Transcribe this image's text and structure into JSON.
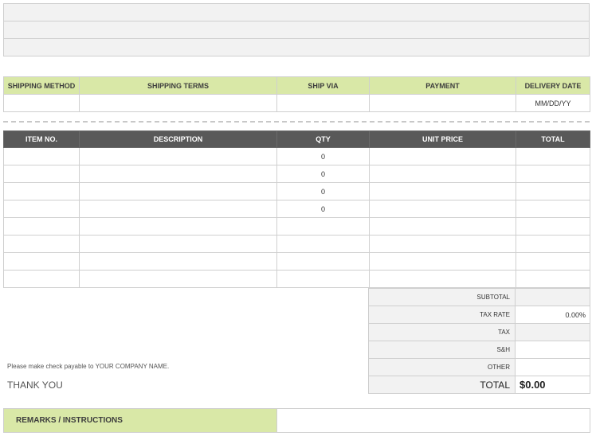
{
  "shipping": {
    "headers": [
      "SHIPPING METHOD",
      "SHIPPING TERMS",
      "SHIP VIA",
      "PAYMENT",
      "DELIVERY DATE"
    ],
    "values": [
      "",
      "",
      "",
      "",
      "MM/DD/YY"
    ]
  },
  "items": {
    "headers": [
      "ITEM NO.",
      "DESCRIPTION",
      "QTY",
      "UNIT PRICE",
      "TOTAL"
    ],
    "rows": [
      [
        "",
        "",
        "0",
        "",
        ""
      ],
      [
        "",
        "",
        "0",
        "",
        ""
      ],
      [
        "",
        "",
        "0",
        "",
        ""
      ],
      [
        "",
        "",
        "0",
        "",
        ""
      ],
      [
        "",
        "",
        "",
        "",
        ""
      ],
      [
        "",
        "",
        "",
        "",
        ""
      ],
      [
        "",
        "",
        "",
        "",
        ""
      ],
      [
        "",
        "",
        "",
        "",
        ""
      ]
    ]
  },
  "totals": {
    "subtotal_label": "SUBTOTAL",
    "subtotal_value": "",
    "tax_rate_label": "TAX RATE",
    "tax_rate_value": "0.00%",
    "tax_label": "TAX",
    "tax_value": "",
    "sh_label": "S&H",
    "sh_value": "",
    "other_label": "OTHER",
    "other_value": "",
    "total_label": "TOTAL",
    "total_value": "$0.00"
  },
  "footer": {
    "payable_note": "Please make check payable to YOUR COMPANY NAME.",
    "thank_you": "THANK YOU"
  },
  "remarks": {
    "label": "REMARKS / INSTRUCTIONS",
    "value": ""
  }
}
